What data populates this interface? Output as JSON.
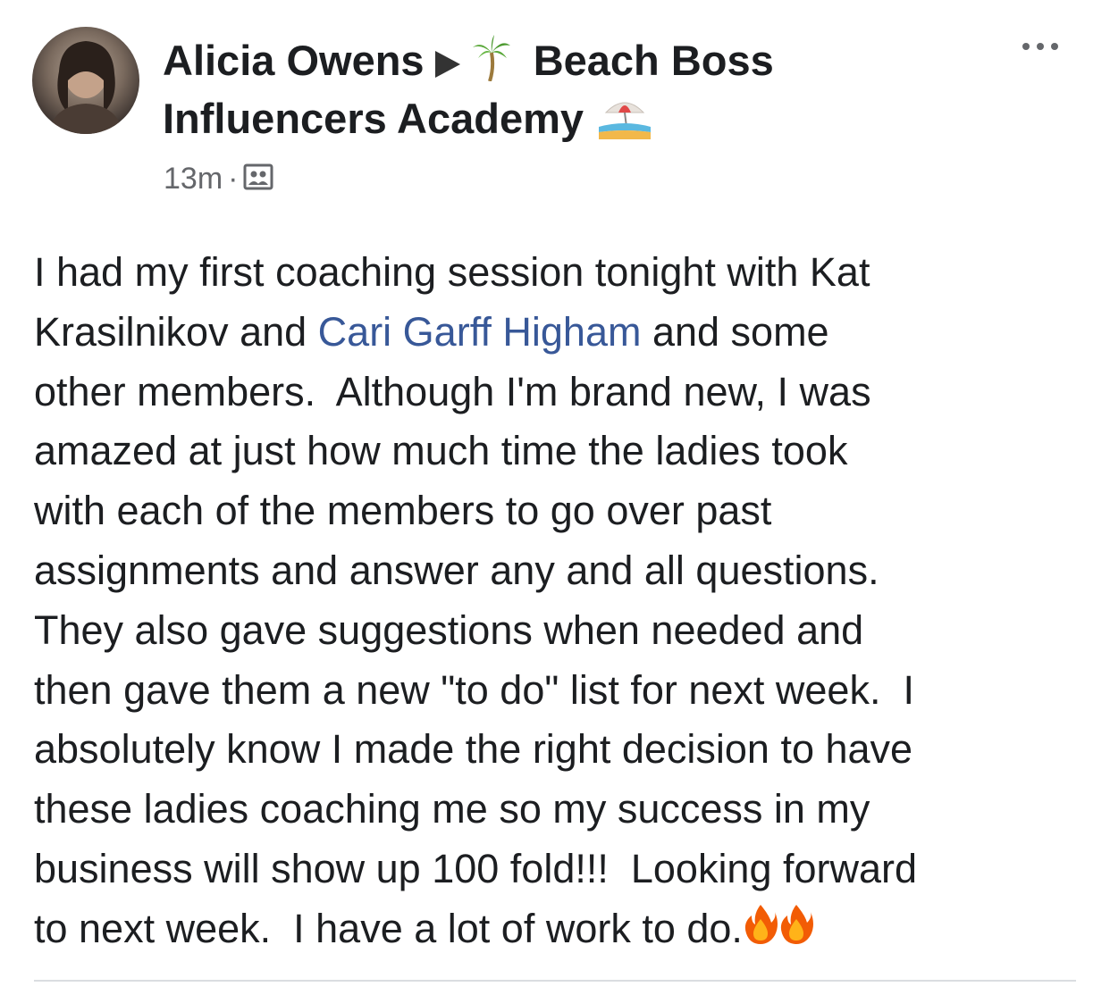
{
  "post": {
    "author": "Alicia Owens",
    "group_name_line1": "Beach Boss",
    "group_name_line2": "Influencers Academy",
    "timestamp": "13m",
    "separator": "·",
    "audience_icon": "group-members-icon",
    "group_prefix_icon": "palm-tree-icon",
    "group_suffix_icon": "beach-umbrella-icon",
    "body_lines": [
      {
        "pre": "I had my first coaching session tonight with Kat"
      },
      {
        "pre": "Krasilnikov and ",
        "mention": "Cari Garff Higham",
        "post": " and some"
      },
      {
        "pre": "other members.  Although I'm brand new, I was"
      },
      {
        "pre": "amazed at just how much time the ladies took"
      },
      {
        "pre": "with each of the members to go over past"
      },
      {
        "pre": "assignments and answer any and all questions."
      },
      {
        "pre": "They also gave suggestions when needed and"
      },
      {
        "pre": "then gave them a new \"to do\" list for next week.  I"
      },
      {
        "pre": "absolutely know I made the right decision to have"
      },
      {
        "pre": "these ladies coaching me so my success in my"
      },
      {
        "pre": "business will show up 100 fold!!!  Looking forward"
      },
      {
        "pre": "to next week.  I have a lot of work to do."
      }
    ],
    "trailing_icons": [
      "fire-icon",
      "fire-icon"
    ],
    "colors": {
      "text": "#1c1e21",
      "meta": "#65676b",
      "mention": "#385898"
    }
  }
}
